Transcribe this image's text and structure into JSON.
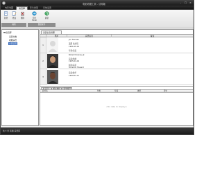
{
  "window": {
    "title": "电影收藏工具 - 试用版",
    "controls": [
      "-",
      "□",
      "×"
    ]
  },
  "menu": {
    "tabs": [
      {
        "label": "电影收藏",
        "active": false
      },
      {
        "label": "演员库",
        "active": true
      },
      {
        "label": "影片类型",
        "active": false
      },
      {
        "label": "系统设置",
        "active": false
      }
    ]
  },
  "ribbon": {
    "buttons": [
      {
        "label": "新增",
        "icon": "new-document-icon"
      },
      {
        "label": "修改",
        "icon": "edit-document-icon"
      },
      {
        "label": "删除",
        "icon": "delete-icon"
      },
      {
        "label": "导出Excel",
        "icon": "export-icon"
      },
      {
        "label": "刷新",
        "icon": "refresh-icon"
      }
    ],
    "groups": [
      "编辑",
      "数据操作"
    ]
  },
  "tree": {
    "root": "演员库",
    "items": [
      {
        "label": "演员分类",
        "selected": false
      },
      {
        "label": "收藏演员",
        "selected": false
      },
      {
        "label": "全部演员",
        "selected": true
      }
    ]
  },
  "main": {
    "tab_label": "演员信息管理",
    "columns": [
      "",
      "照片",
      "演员信息",
      "备注"
    ],
    "rows": [
      {
        "num": "1",
        "lines": [
          "Jon Favreau",
          "美国 洛杉矶",
          "1966-10-19",
          "导演/演员"
        ]
      },
      {
        "num": "2",
        "lines": [
          "Robert Downey Jr.",
          "演员/监制",
          "1965-04-04",
          "制片/演员",
          "Terrence Howard"
        ]
      },
      {
        "num": "3",
        "lines": [
          "演员/歌手",
          "1969-03-11"
        ]
      }
    ]
  },
  "sub": {
    "tabs": [
      {
        "label": "参演影片",
        "active": true
      },
      {
        "label": "相关图片",
        "active": false
      },
      {
        "label": "获奖情况",
        "active": false
      }
    ],
    "columns": [
      "影片名",
      "年份",
      "导演",
      "类型",
      "评分"
    ],
    "empty": "<No data to display>"
  },
  "status": {
    "text": "共 3 条 就绪 演员库"
  }
}
